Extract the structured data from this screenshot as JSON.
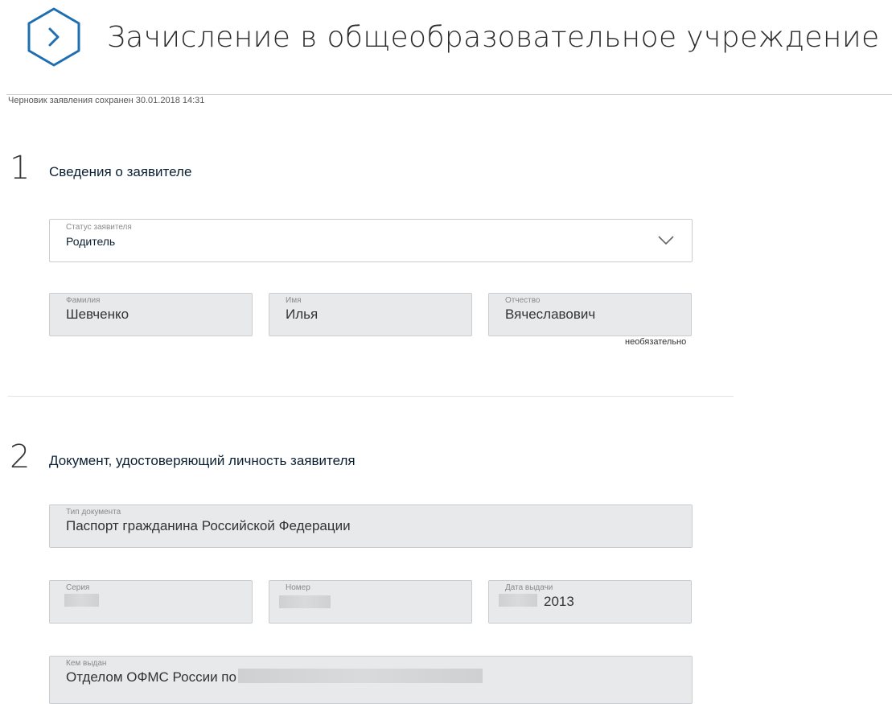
{
  "header": {
    "title": "Зачисление в общеобразовательное учреждение",
    "icon": "chevron-right-icon",
    "accent_color": "#1e6fb2"
  },
  "draft_status": "Черновик заявления сохранен 30.01.2018 14:31",
  "section1": {
    "number": "1",
    "title": "Сведения о заявителе",
    "status": {
      "label": "Статус заявителя",
      "value": "Родитель"
    },
    "last_name": {
      "label": "Фамилия",
      "value": "Шевченко"
    },
    "first_name": {
      "label": "Имя",
      "value": "Илья"
    },
    "patronymic": {
      "label": "Отчество",
      "value": "Вячеславович",
      "hint": "необязательно"
    }
  },
  "section2": {
    "number": "2",
    "title": "Документ, удостоверяющий личность заявителя",
    "doc_type": {
      "label": "Тип документа",
      "value": "Паспорт гражданина Российской Федерации"
    },
    "series": {
      "label": "Серия"
    },
    "number_field": {
      "label": "Номер"
    },
    "issue_date": {
      "label": "Дата выдачи",
      "value_visible": "2013"
    },
    "issued_by": {
      "label": "Кем выдан",
      "value_visible": "Отделом ОФМС России по"
    }
  }
}
